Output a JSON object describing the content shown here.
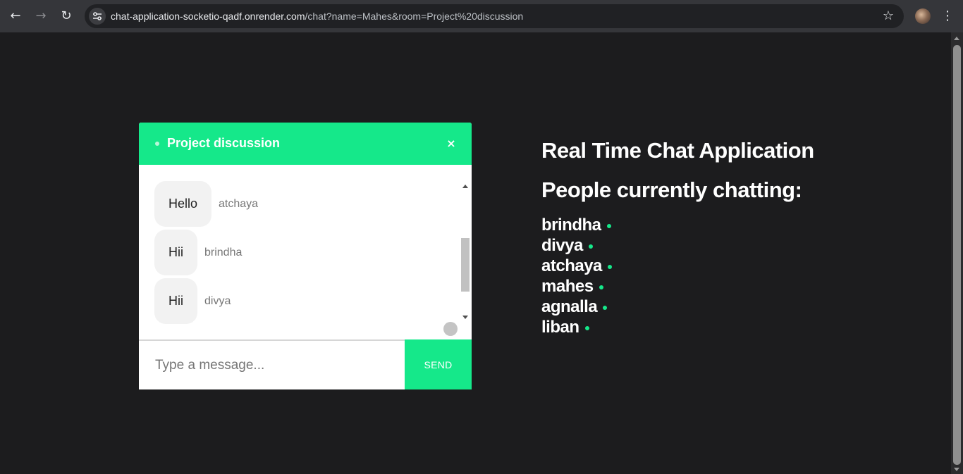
{
  "browser": {
    "url_host": "chat-application-socketio-qadf.onrender.com",
    "url_path": "/chat?name=Mahes&room=Project%20discussion"
  },
  "chat": {
    "room_name": "Project discussion",
    "close_label": "×",
    "messages": [
      {
        "text": "Hello",
        "sender": "atchaya"
      },
      {
        "text": "Hii",
        "sender": "brindha"
      },
      {
        "text": "Hii",
        "sender": "divya"
      }
    ],
    "input_placeholder": "Type a message...",
    "send_label": "SEND"
  },
  "sidebar": {
    "title": "Real Time Chat Application",
    "people_heading": "People currently chatting:",
    "people": [
      "brindha",
      "divya",
      "atchaya",
      "mahes",
      "agnalla",
      "liban"
    ]
  },
  "colors": {
    "accent": "#15e88a",
    "background": "#1c1c1e"
  }
}
